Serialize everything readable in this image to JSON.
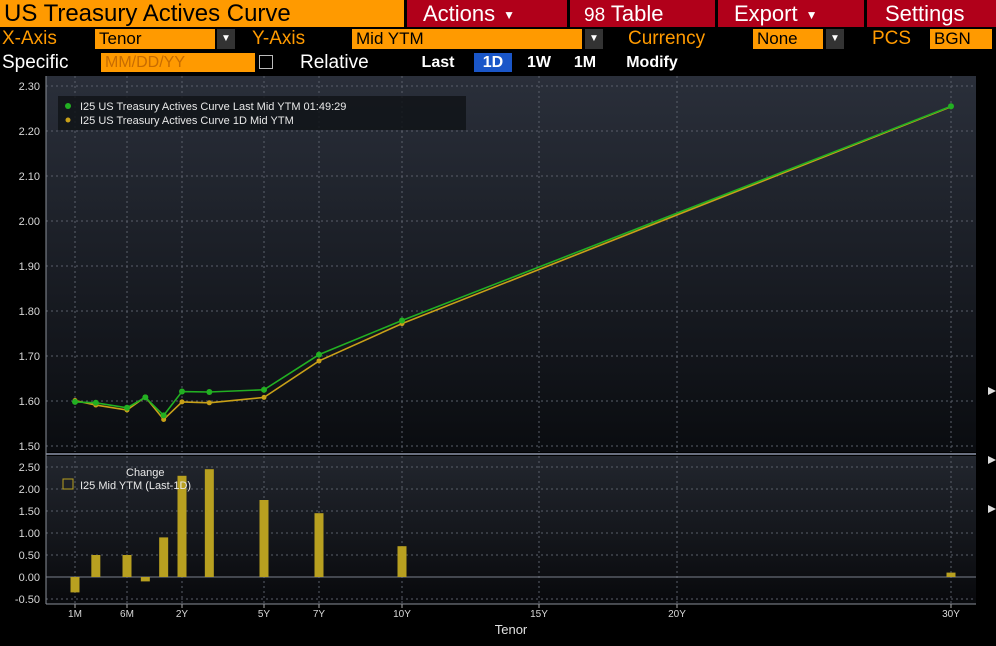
{
  "window": {
    "title": "US Treasury Actives Curve"
  },
  "menus": {
    "actions": "Actions",
    "table_num": "98",
    "table": "Table",
    "export": "Export",
    "settings": "Settings"
  },
  "controls": {
    "x_axis_label": "X-Axis",
    "x_axis_value": "Tenor",
    "y_axis_label": "Y-Axis",
    "y_axis_value": "Mid YTM",
    "currency_label": "Currency",
    "currency_value": "None",
    "pcs_label": "PCS",
    "pcs_value": "BGN",
    "specific_label": "Specific",
    "date_placeholder": "MM/DD/YY",
    "relative_label": "Relative",
    "ranges": [
      "Last",
      "1D",
      "1W",
      "1M",
      "Modify"
    ],
    "active_range": "1D"
  },
  "colors": {
    "brand_orange": "#ff9a00",
    "menu_red": "#b1001a",
    "last_series": "#22b022",
    "prior_series": "#c8a018",
    "bar": "#b8a020",
    "active_button": "#1a56c8"
  },
  "chart_data": [
    {
      "type": "line",
      "x_tick_labels": [
        "1M",
        "6M",
        "2Y",
        "5Y",
        "7Y",
        "10Y",
        "15Y",
        "20Y",
        "30Y"
      ],
      "x_ticks": [
        0.083,
        0.5,
        2,
        5,
        7,
        10,
        15,
        20,
        30
      ],
      "ylim": [
        1.48,
        2.31
      ],
      "yticks": [
        "2.30",
        "2.20",
        "2.10",
        "2.00",
        "1.90",
        "1.80",
        "1.70",
        "1.60",
        "1.50"
      ],
      "series": [
        {
          "name": "I25 US Treasury Actives Curve Last Mid YTM 01:49:29",
          "x": [
            0.083,
            0.25,
            0.5,
            1,
            1.5,
            2,
            3,
            5,
            7,
            10,
            30
          ],
          "y": [
            1.598,
            1.596,
            1.585,
            1.608,
            1.568,
            1.621,
            1.62,
            1.625,
            1.703,
            1.779,
            2.255
          ]
        },
        {
          "name": "I25 US Treasury Actives Curve 1D Mid YTM",
          "x": [
            0.083,
            0.25,
            0.5,
            1,
            1.5,
            2,
            3,
            5,
            7,
            10,
            30
          ],
          "y": [
            1.601,
            1.591,
            1.58,
            1.609,
            1.559,
            1.598,
            1.596,
            1.608,
            1.689,
            1.772,
            2.254
          ]
        }
      ]
    },
    {
      "type": "bar",
      "title": "Change",
      "x_tick_labels": [
        "1M",
        "6M",
        "2Y",
        "5Y",
        "7Y",
        "10Y",
        "15Y",
        "20Y",
        "30Y"
      ],
      "x": [
        0.083,
        0.25,
        0.5,
        1,
        1.5,
        2,
        3,
        5,
        7,
        10,
        30
      ],
      "values": [
        -0.35,
        0.5,
        0.5,
        -0.1,
        0.9,
        2.3,
        2.45,
        1.75,
        1.45,
        0.7,
        0.1
      ],
      "ylim": [
        -0.6,
        2.6
      ],
      "yticks": [
        "2.50",
        "2.00",
        "1.50",
        "1.00",
        "0.50",
        "0.00",
        "-0.50"
      ],
      "series_name": "I25 Mid YTM (Last-1D)",
      "xlabel": "Tenor"
    }
  ]
}
